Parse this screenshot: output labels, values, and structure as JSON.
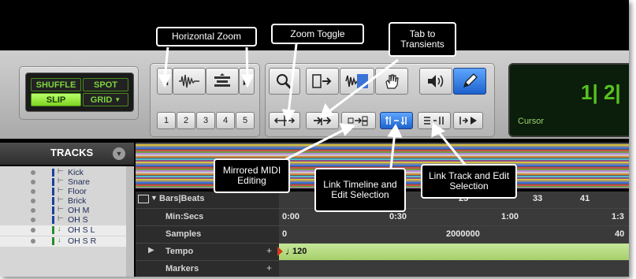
{
  "mode_buttons": {
    "shuffle": "SHUFFLE",
    "spot": "SPOT",
    "slip": "SLIP",
    "grid": "GRID"
  },
  "zoom_presets": [
    "1",
    "2",
    "3",
    "4",
    "5"
  ],
  "counter": {
    "value": "1| 2|",
    "cursor_label": "Cursor"
  },
  "tracks": {
    "title": "TRACKS",
    "items": [
      {
        "name": "Kick"
      },
      {
        "name": "Snare"
      },
      {
        "name": "Floor"
      },
      {
        "name": "Brick"
      },
      {
        "name": "OH M"
      },
      {
        "name": "OH S"
      },
      {
        "name": "OH S L"
      },
      {
        "name": "OH S R"
      }
    ]
  },
  "rulers": {
    "bars_beats": {
      "label": "Bars|Beats",
      "ticks": [
        "25",
        "33",
        "41"
      ]
    },
    "min_secs": {
      "label": "Min:Secs",
      "ticks": [
        "0:00",
        "0:30",
        "1:00",
        "1:3"
      ]
    },
    "samples": {
      "label": "Samples",
      "ticks": [
        "0",
        "2000000",
        "40"
      ]
    },
    "tempo": {
      "label": "Tempo",
      "value": "120"
    },
    "markers": {
      "label": "Markers"
    }
  },
  "callouts": {
    "horizontal_zoom": "Horizontal Zoom",
    "zoom_toggle": "Zoom Toggle",
    "tab_to_transients": "Tab to Transients",
    "mirrored_midi": "Mirrored MIDI Editing",
    "link_timeline": "Link Timeline and Edit Selection",
    "link_track": "Link Track and Edit Selection"
  },
  "overview_colors": [
    "#d6c23f",
    "#8a8a8a",
    "#3f6fd6",
    "#c84f4f",
    "#6f9c3f",
    "#b98ad6",
    "#c8c8c8",
    "#d68a3f",
    "#4fbfc8",
    "#8c4f8c"
  ]
}
